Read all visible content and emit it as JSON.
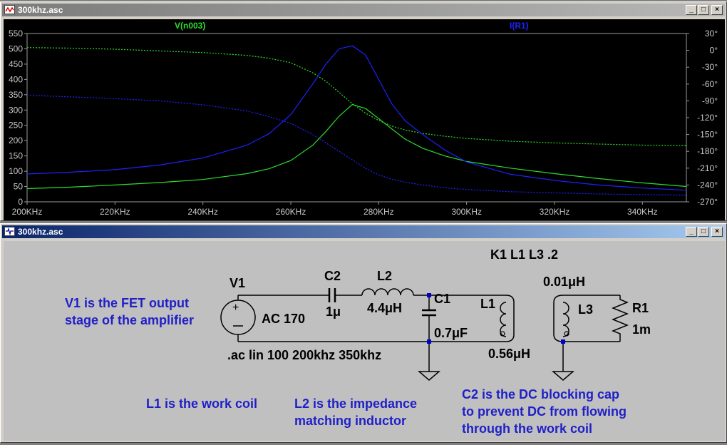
{
  "windows": {
    "plot": {
      "title": "300khz.asc"
    },
    "schematic": {
      "title": "300khz.asc"
    }
  },
  "chart_data": {
    "type": "line",
    "trace_labels": [
      "V(n003)",
      "I(R1)"
    ],
    "x_ticks": [
      "200KHz",
      "220KHz",
      "240KHz",
      "260KHz",
      "280KHz",
      "300KHz",
      "320KHz",
      "340KHz"
    ],
    "xlim": [
      200,
      350
    ],
    "y_left_ticks": [
      "550",
      "500",
      "450",
      "400",
      "350",
      "300",
      "250",
      "200",
      "150",
      "100",
      "50",
      "0"
    ],
    "ylim_left": [
      0,
      550
    ],
    "y_right_ticks": [
      "30°",
      "0°",
      "-30°",
      "-60°",
      "-90°",
      "-120°",
      "-150°",
      "-180°",
      "-210°",
      "-240°",
      "-270°"
    ],
    "ylim_right": [
      -270,
      30
    ],
    "series": [
      {
        "name": "V(n003)",
        "color": "#2cdc2c",
        "axis": "left",
        "style": "solid",
        "x": [
          200,
          210,
          220,
          230,
          240,
          250,
          255,
          260,
          265,
          268,
          271,
          274,
          277,
          280,
          283,
          286,
          290,
          295,
          300,
          310,
          320,
          330,
          340,
          350
        ],
        "y": [
          43,
          48,
          55,
          63,
          73,
          92,
          108,
          135,
          185,
          230,
          280,
          318,
          305,
          272,
          238,
          205,
          175,
          150,
          132,
          110,
          92,
          76,
          62,
          50
        ]
      },
      {
        "name": "V(n003) phase",
        "color": "#2cdc2c",
        "axis": "right",
        "style": "dashed",
        "x": [
          200,
          210,
          220,
          230,
          240,
          250,
          255,
          260,
          265,
          268,
          271,
          274,
          277,
          280,
          283,
          286,
          290,
          295,
          300,
          310,
          320,
          330,
          340,
          350
        ],
        "y": [
          5,
          4,
          2,
          -1,
          -4,
          -9,
          -14,
          -22,
          -40,
          -55,
          -75,
          -95,
          -112,
          -125,
          -135,
          -142,
          -148,
          -153,
          -157,
          -162,
          -165,
          -167,
          -169,
          -170
        ]
      },
      {
        "name": "I(R1)",
        "color": "#2020ff",
        "axis": "left",
        "style": "solid",
        "x": [
          200,
          210,
          220,
          230,
          240,
          250,
          255,
          260,
          265,
          268,
          271,
          274,
          277,
          280,
          283,
          286,
          290,
          295,
          300,
          310,
          320,
          330,
          340,
          350
        ],
        "y": [
          91,
          97,
          105,
          120,
          143,
          185,
          222,
          285,
          385,
          450,
          500,
          510,
          480,
          400,
          320,
          265,
          220,
          170,
          130,
          90,
          70,
          55,
          45,
          38
        ]
      },
      {
        "name": "I(R1) phase",
        "color": "#2020ff",
        "axis": "right",
        "style": "dashed",
        "x": [
          200,
          210,
          220,
          230,
          240,
          250,
          255,
          260,
          265,
          268,
          271,
          274,
          277,
          280,
          283,
          286,
          290,
          295,
          300,
          310,
          320,
          330,
          340,
          350
        ],
        "y": [
          -80,
          -83,
          -86,
          -90,
          -97,
          -108,
          -118,
          -130,
          -150,
          -165,
          -180,
          -195,
          -210,
          -222,
          -230,
          -235,
          -240,
          -245,
          -248,
          -252,
          -254,
          -256,
          -257,
          -258
        ]
      }
    ]
  },
  "schematic": {
    "k_directive": "K1 L1 L3 .2",
    "v1_label": "V1",
    "v1_value": "AC 170",
    "c2_label": "C2",
    "c2_value": "1μ",
    "l2_label": "L2",
    "l2_value": "4.4μH",
    "c1_label": "C1",
    "c1_value": "0.7μF",
    "l1_label": "L1",
    "l1_value": "0.56μH",
    "l3_label": "L3",
    "l3_value": "0.01μH",
    "r1_label": "R1",
    "r1_value": "1m",
    "ac_directive": ".ac lin 100 200khz 350khz",
    "notes": {
      "v1_line1": "V1 is the FET output",
      "v1_line2": "stage of the amplifier",
      "l1": "L1 is the work coil",
      "l2_line1": "L2 is the impedance",
      "l2_line2": "matching inductor",
      "c2_line1": "C2 is the DC blocking cap",
      "c2_line2": "to prevent DC from flowing",
      "c2_line3": "through the work coil"
    }
  }
}
